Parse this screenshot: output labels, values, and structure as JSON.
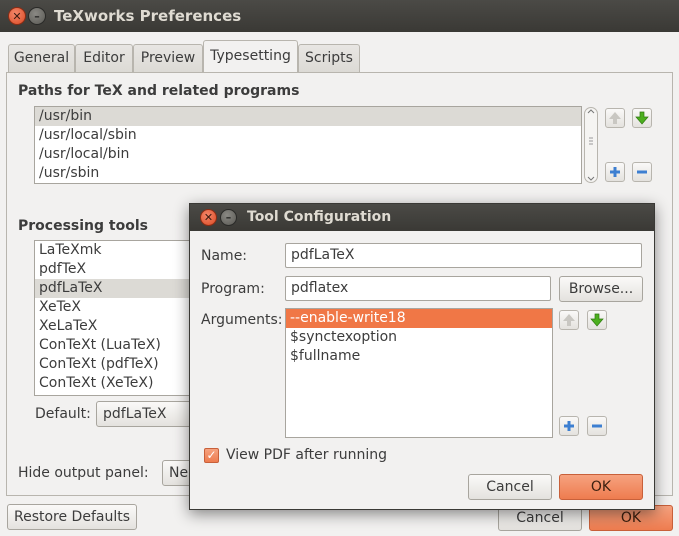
{
  "window": {
    "title": "TeXworks Preferences",
    "close_glyph": "✕",
    "minimize_glyph": "–"
  },
  "tabs": [
    {
      "label": "General"
    },
    {
      "label": "Editor"
    },
    {
      "label": "Preview"
    },
    {
      "label": "Typesetting",
      "active": true
    },
    {
      "label": "Scripts"
    }
  ],
  "paths": {
    "title": "Paths for TeX and related programs",
    "items": [
      "/usr/bin",
      "/usr/local/sbin",
      "/usr/local/bin",
      "/usr/sbin"
    ],
    "selected_index": 0
  },
  "processing": {
    "title": "Processing tools",
    "items": [
      "LaTeXmk",
      "pdfTeX",
      "pdfLaTeX",
      "XeTeX",
      "XeLaTeX",
      "ConTeXt (LuaTeX)",
      "ConTeXt (pdfTeX)",
      "ConTeXt (XeTeX)"
    ],
    "selected_index": 2,
    "default_label": "Default:",
    "default_value": "pdfLaTeX"
  },
  "hide_output": {
    "label": "Hide output panel:",
    "value": "Ne"
  },
  "footer": {
    "restore_label": "Restore Defaults",
    "cancel_label": "Cancel",
    "ok_label": "OK"
  },
  "dialog": {
    "title": "Tool Configuration",
    "name_label": "Name:",
    "name_value": "pdfLaTeX",
    "program_label": "Program:",
    "program_value": "pdflatex",
    "browse_label": "Browse...",
    "arguments_label": "Arguments:",
    "arguments": [
      "--enable-write18",
      "$synctexoption",
      "$fullname"
    ],
    "selected_argument_index": 0,
    "view_pdf_label": "View PDF after running",
    "view_pdf_checked": true,
    "cancel_label": "Cancel",
    "ok_label": "OK"
  },
  "colors": {
    "accent": "#f07746",
    "titlebar": "#3c3b37",
    "arrow_green": "#4caf1e"
  },
  "icons": {
    "up": "arrow-up-icon",
    "down": "arrow-down-icon",
    "add": "plus-icon",
    "remove": "minus-icon",
    "check": "✓"
  }
}
